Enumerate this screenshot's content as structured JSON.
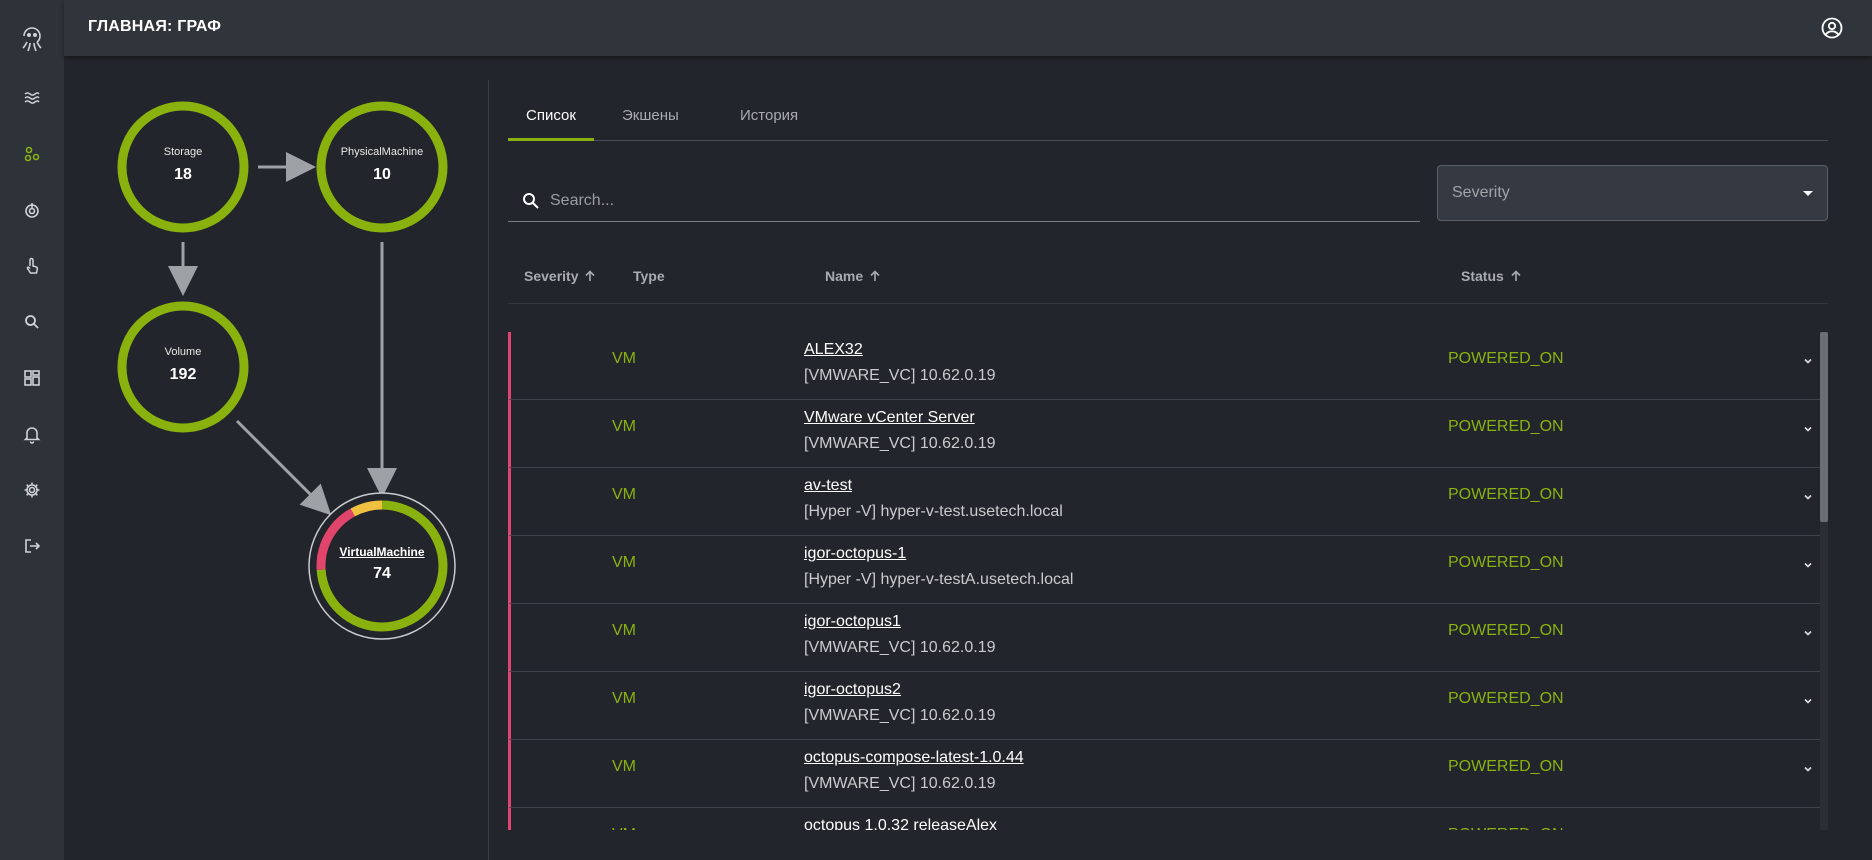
{
  "header": {
    "title": "ГЛАВНАЯ: ГРАФ",
    "account_icon": "account-circle-icon"
  },
  "sidebar": {
    "items": [
      {
        "icon": "octopus-logo-icon"
      },
      {
        "icon": "waves-icon"
      },
      {
        "icon": "graph-icon",
        "active": true
      },
      {
        "icon": "power-icon"
      },
      {
        "icon": "touch-icon"
      },
      {
        "icon": "search-icon"
      },
      {
        "icon": "dashboard-icon"
      },
      {
        "icon": "bell-icon"
      },
      {
        "icon": "gear-icon"
      },
      {
        "icon": "logout-icon"
      }
    ]
  },
  "graph": {
    "nodes": [
      {
        "label": "Storage",
        "count": "18"
      },
      {
        "label": "PhysicalMachine",
        "count": "10"
      },
      {
        "label": "Volume",
        "count": "192"
      },
      {
        "label": "VirtualMachine",
        "count": "74"
      }
    ],
    "virtual_machine_breakdown": [
      {
        "state": "ok",
        "fraction": 0.74,
        "color": "#8ab20f"
      },
      {
        "state": "critical",
        "fraction": 0.18,
        "color": "#e2456b"
      },
      {
        "state": "warning",
        "fraction": 0.08,
        "color": "#f0c040"
      }
    ]
  },
  "tabs": [
    {
      "label": "Список",
      "active": true
    },
    {
      "label": "Экшены",
      "active": false
    },
    {
      "label": "История",
      "active": false
    }
  ],
  "search": {
    "placeholder": "Search...",
    "value": ""
  },
  "severity_filter": {
    "value": "Severity"
  },
  "table": {
    "columns": [
      "Severity",
      "Type",
      "Name",
      "Status"
    ],
    "rows": [
      {
        "type": "VM",
        "name": "ALEX32",
        "host": "[VMWARE_VC] 10.62.0.19",
        "status": "POWERED_ON"
      },
      {
        "type": "VM",
        "name": "VMware vCenter Server",
        "host": "[VMWARE_VC] 10.62.0.19",
        "status": "POWERED_ON"
      },
      {
        "type": "VM",
        "name": "av-test",
        "host": "[Hyper -V] hyper-v-test.usetech.local",
        "status": "POWERED_ON"
      },
      {
        "type": "VM",
        "name": "igor-octopus-1",
        "host": "[Hyper -V] hyper-v-testA.usetech.local",
        "status": "POWERED_ON"
      },
      {
        "type": "VM",
        "name": "igor-octopus1",
        "host": "[VMWARE_VC] 10.62.0.19",
        "status": "POWERED_ON"
      },
      {
        "type": "VM",
        "name": "igor-octopus2",
        "host": "[VMWARE_VC] 10.62.0.19",
        "status": "POWERED_ON"
      },
      {
        "type": "VM",
        "name": "octopus-compose-latest-1.0.44",
        "host": "[VMWARE_VC] 10.62.0.19",
        "status": "POWERED_ON"
      },
      {
        "type": "VM",
        "name": "octopus 1.0.32 releaseAlex",
        "host": "",
        "status": "POWERED_ON"
      }
    ]
  },
  "colors": {
    "accent": "#8ab20f",
    "critical": "#e2456b",
    "warning": "#f0c040"
  }
}
